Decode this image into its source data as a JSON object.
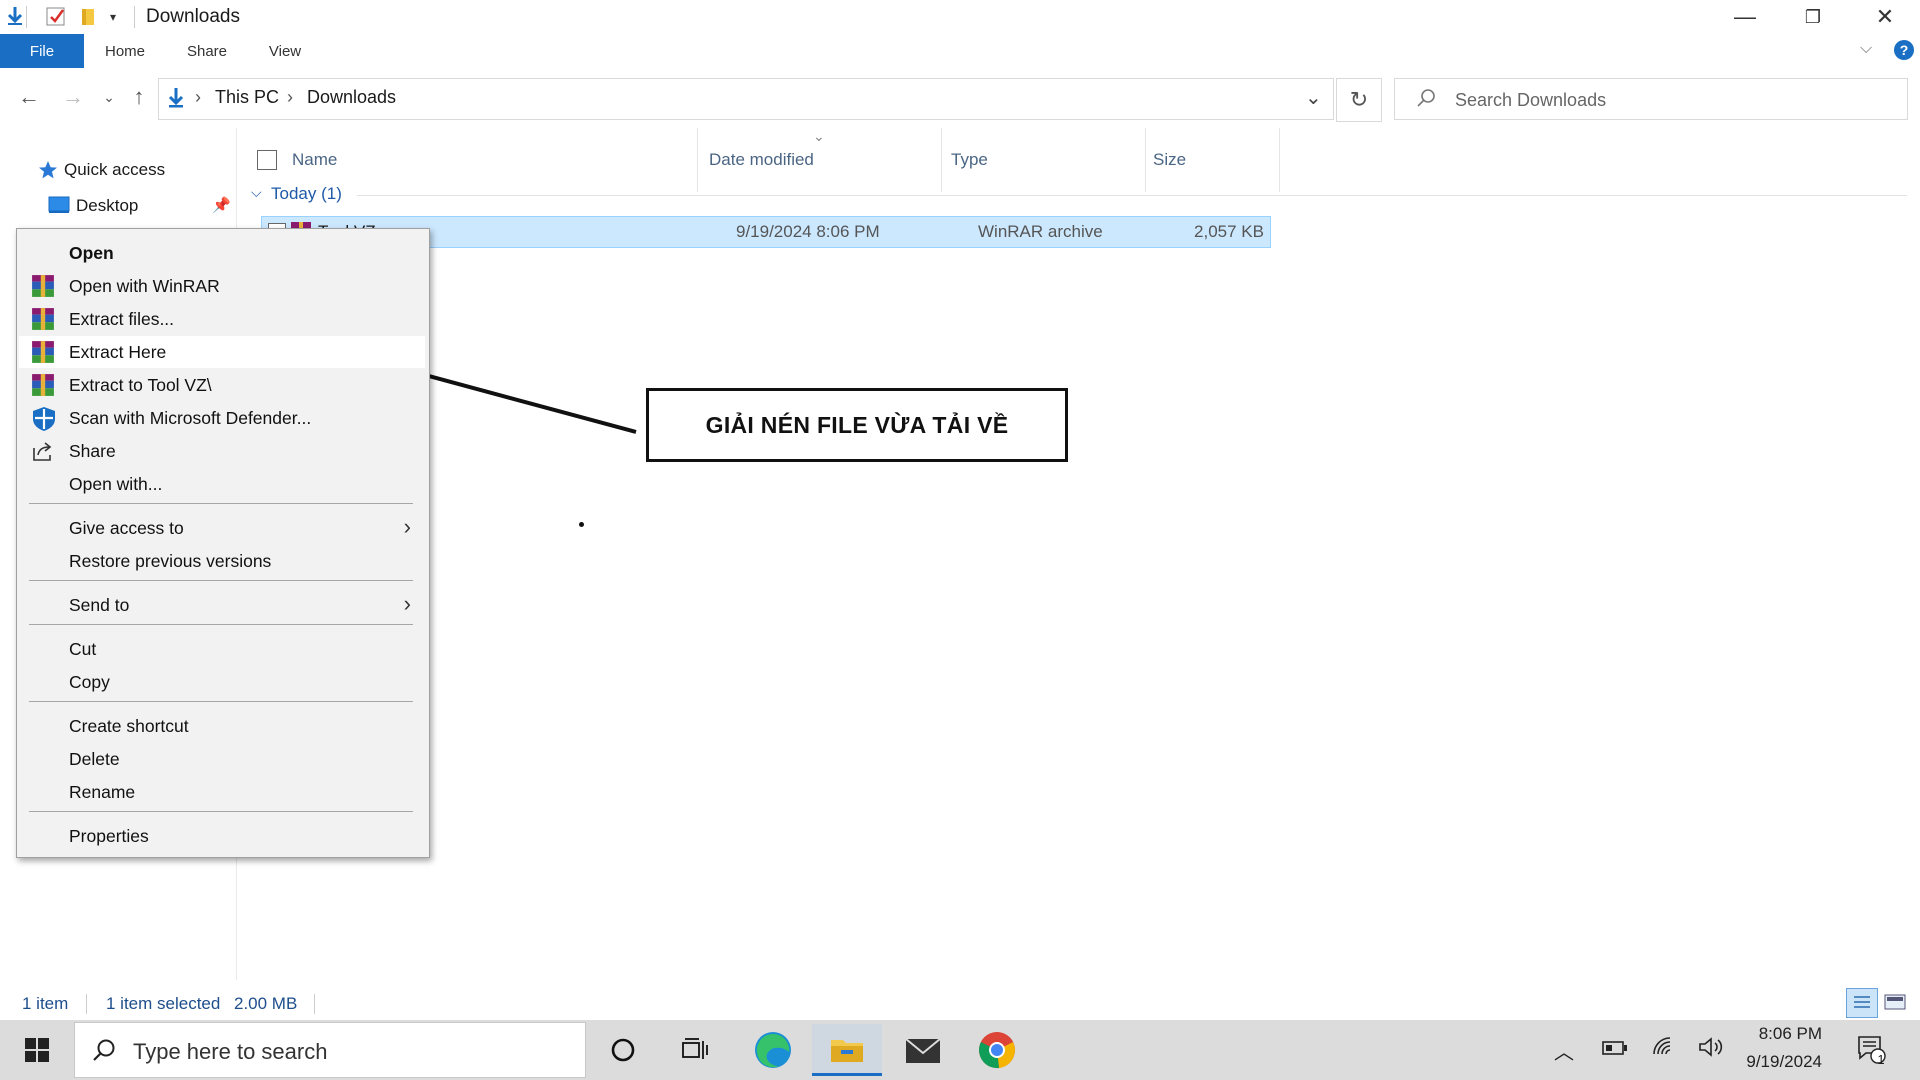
{
  "window": {
    "title": "Downloads",
    "minimize_glyph": "—",
    "maximize_glyph": "❐",
    "close_glyph": "✕"
  },
  "ribbon": {
    "tabs": [
      "File",
      "Home",
      "Share",
      "View"
    ],
    "help_glyph": "?"
  },
  "address": {
    "crumbs": [
      "This PC",
      "Downloads"
    ],
    "separator": "›"
  },
  "search": {
    "placeholder": "Search Downloads"
  },
  "nav_pane": {
    "quick_access": "Quick access",
    "desktop": "Desktop"
  },
  "file_list": {
    "columns": [
      "Name",
      "Date modified",
      "Type",
      "Size"
    ],
    "group": "Today (1)",
    "rows": [
      {
        "name": "Tool VZ",
        "date": "9/19/2024 8:06 PM",
        "type": "WinRAR archive",
        "size": "2,057 KB"
      }
    ]
  },
  "context_menu": {
    "items": [
      {
        "label": "Open",
        "bold": true
      },
      {
        "label": "Open with WinRAR",
        "icon": "winrar-icon"
      },
      {
        "label": "Extract files...",
        "icon": "winrar-icon"
      },
      {
        "label": "Extract Here",
        "icon": "winrar-icon",
        "highlighted": true
      },
      {
        "label": "Extract to Tool VZ\\",
        "icon": "winrar-icon"
      },
      {
        "label": "Scan with Microsoft Defender...",
        "icon": "defender-shield-icon"
      },
      {
        "label": "Share",
        "icon": "share-icon"
      },
      {
        "label": "Open with..."
      },
      {
        "label": "Give access to",
        "submenu": true
      },
      {
        "label": "Restore previous versions"
      },
      {
        "label": "Send to",
        "submenu": true
      },
      {
        "label": "Cut"
      },
      {
        "label": "Copy"
      },
      {
        "label": "Create shortcut"
      },
      {
        "label": "Delete"
      },
      {
        "label": "Rename"
      },
      {
        "label": "Properties"
      }
    ]
  },
  "annotation": {
    "text": "GIẢI NÉN FILE VỪA TẢI VỀ"
  },
  "status_bar": {
    "count": "1 item",
    "selection": "1 item selected",
    "size": "2.00 MB"
  },
  "taskbar": {
    "search_placeholder": "Type here to search",
    "time": "8:06 PM",
    "date": "9/19/2024",
    "notification_count": "1"
  },
  "colors": {
    "accent": "#1a6fc4",
    "selection_bg": "#cce8ff",
    "selection_border": "#99d1ff",
    "menu_bg": "#f2f2f2"
  }
}
